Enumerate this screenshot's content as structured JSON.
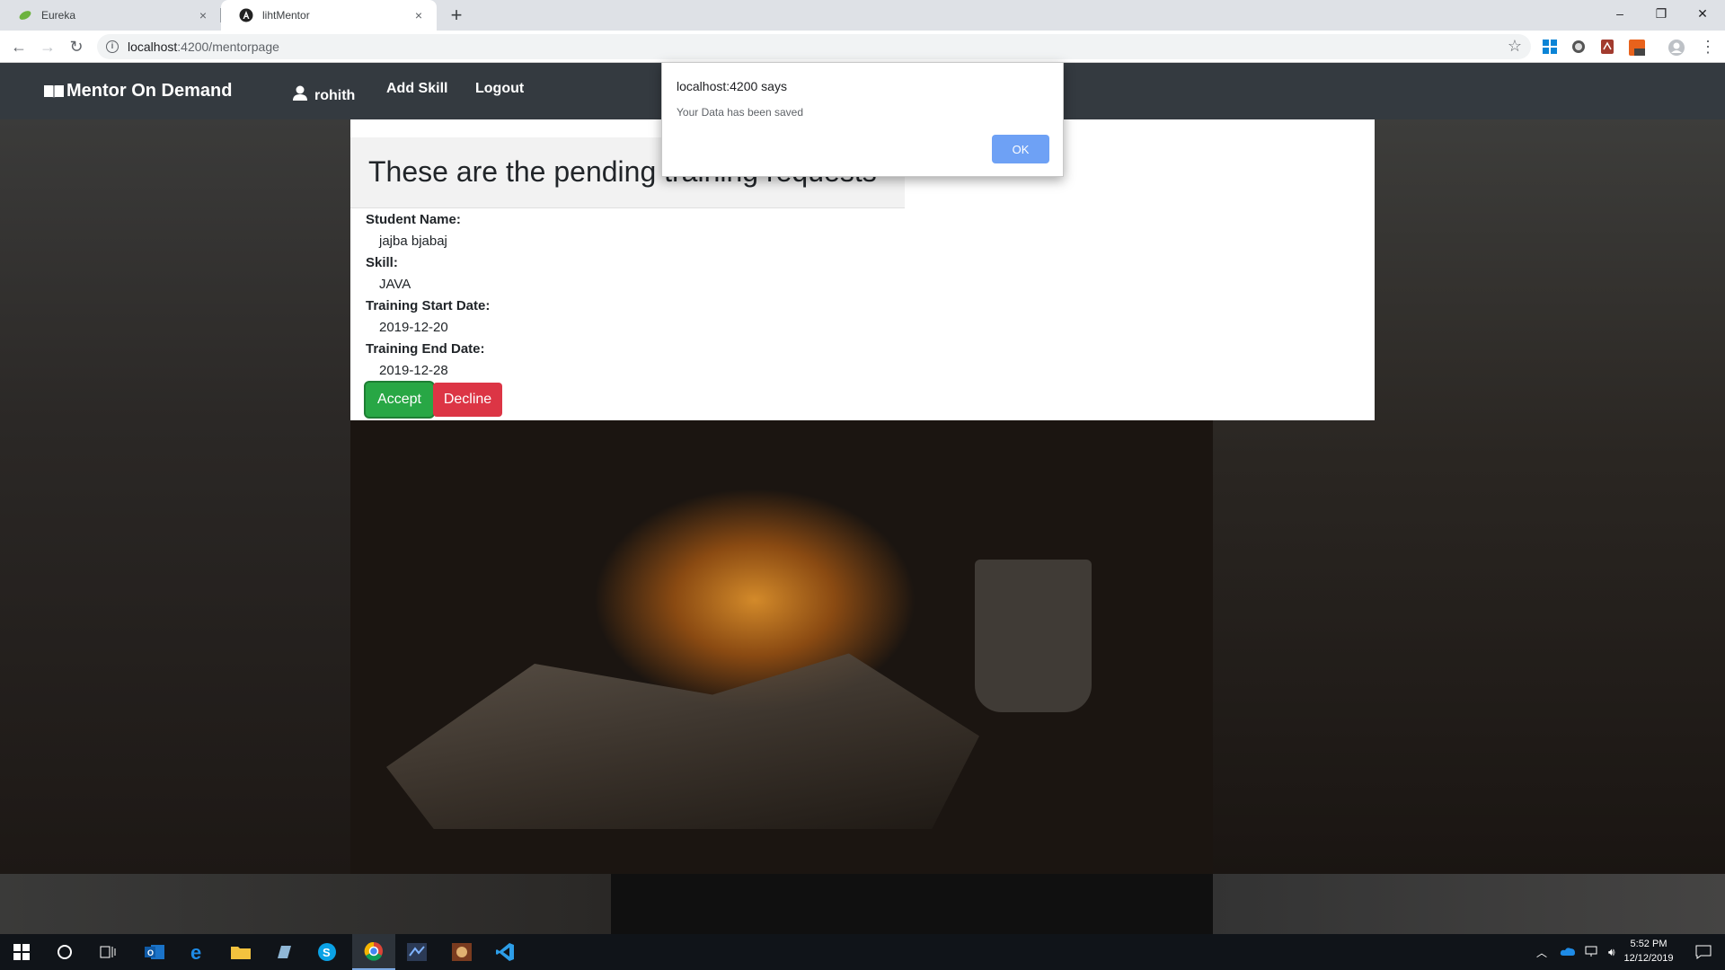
{
  "browser": {
    "tabs": [
      {
        "title": "Eureka",
        "active": false
      },
      {
        "title": "lihtMentor",
        "active": true
      }
    ],
    "url_host": "localhost",
    "url_path": ":4200/mentorpage",
    "new_tab": "+",
    "close_glyph": "×"
  },
  "navbar": {
    "brand": "Mentor On Demand",
    "user": "rohith",
    "add_skill": "Add Skill",
    "logout": "Logout"
  },
  "request": {
    "heading": "These are the pending training requests",
    "student_label": "Student Name:",
    "student_value": "jajba bjabaj",
    "skill_label": "Skill:",
    "skill_value": "JAVA",
    "start_label": "Training Start Date:",
    "start_value": "2019-12-20",
    "end_label": "Training End Date:",
    "end_value": "2019-12-28",
    "accept": "Accept",
    "decline": "Decline"
  },
  "dialog": {
    "title": "localhost:4200 says",
    "message": "Your Data has been saved",
    "ok": "OK"
  },
  "taskbar": {
    "time": "5:52 PM",
    "date": "12/12/2019"
  },
  "colors": {
    "navbar": "#343a40",
    "accept": "#28a745",
    "decline": "#dc3545",
    "dialog_ok": "#6ea1f5"
  }
}
